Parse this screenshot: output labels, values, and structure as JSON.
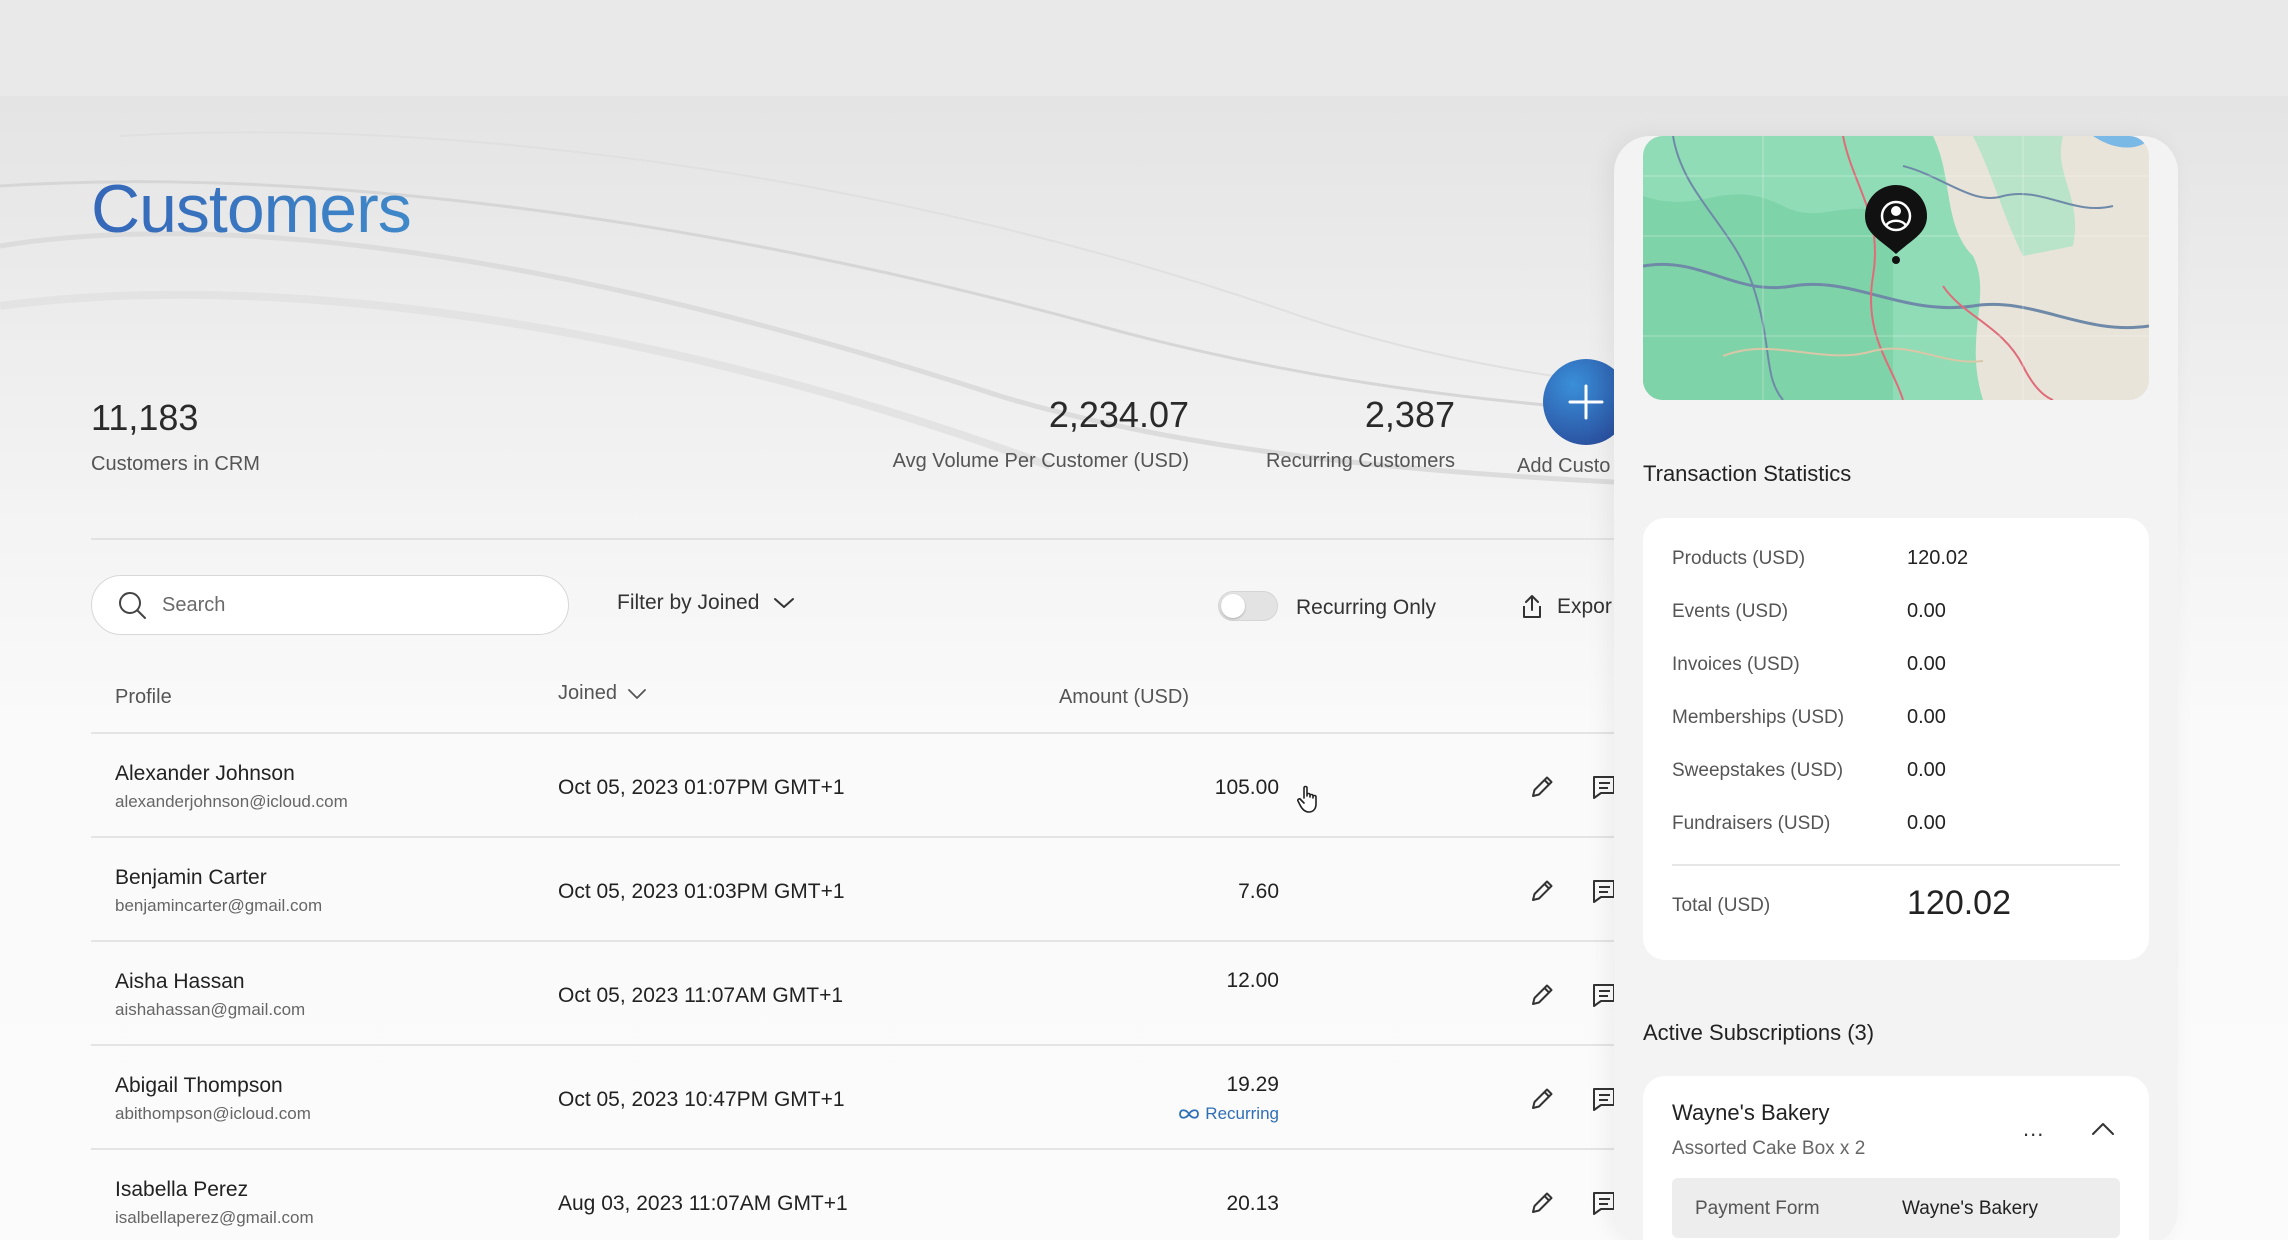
{
  "page": {
    "title": "Customers"
  },
  "stats": {
    "crm_count": "11,183",
    "crm_label": "Customers in CRM",
    "avg_volume": "2,234.07",
    "avg_volume_label": "Avg Volume Per Customer (USD)",
    "recurring": "2,387",
    "recurring_label": "Recurring Customers"
  },
  "add_customer": {
    "label": "Add Custo"
  },
  "toolbar": {
    "search_placeholder": "Search",
    "filter_label": "Filter by Joined",
    "toggle_label": "Recurring Only",
    "toggle_on": false,
    "export_label": "Expor"
  },
  "table": {
    "headers": {
      "profile": "Profile",
      "joined": "Joined",
      "amount": "Amount (USD)"
    },
    "rows": [
      {
        "name": "Alexander Johnson",
        "email": "alexanderjohnson@icloud.com",
        "joined": "Oct 05, 2023 01:07PM GMT+1",
        "amount": "105.00",
        "recurring": ""
      },
      {
        "name": "Benjamin Carter",
        "email": "benjamincarter@gmail.com",
        "joined": "Oct 05, 2023 01:03PM GMT+1",
        "amount": "7.60",
        "recurring": ""
      },
      {
        "name": "Aisha Hassan",
        "email": "aishahassan@gmail.com",
        "joined": "Oct 05, 2023 11:07AM GMT+1",
        "amount": "12.00",
        "recurring": ""
      },
      {
        "name": "Abigail Thompson",
        "email": "abithompson@icloud.com",
        "joined": "Oct 05, 2023 10:47PM GMT+1",
        "amount": "19.29",
        "recurring": "Recurring"
      },
      {
        "name": "Isabella Perez",
        "email": "isalbellaperez@gmail.com",
        "joined": "Aug 03, 2023 11:07AM GMT+1",
        "amount": "20.13",
        "recurring": ""
      }
    ]
  },
  "panel": {
    "transaction_title": "Transaction Statistics",
    "transactions": [
      {
        "label": "Products (USD)",
        "value": "120.02"
      },
      {
        "label": "Events (USD)",
        "value": "0.00"
      },
      {
        "label": "Invoices (USD)",
        "value": "0.00"
      },
      {
        "label": "Memberships (USD)",
        "value": "0.00"
      },
      {
        "label": "Sweepstakes (USD)",
        "value": "0.00"
      },
      {
        "label": "Fundraisers (USD)",
        "value": "0.00"
      }
    ],
    "total_label": "Total (USD)",
    "total_value": "120.02",
    "subscriptions_title": "Active Subscriptions (3)",
    "subscription": {
      "name": "Wayne's Bakery",
      "desc": "Assorted Cake Box x 2",
      "more": "...",
      "payment_label": "Payment Form",
      "payment_value": "Wayne's Bakery"
    }
  },
  "colors": {
    "accent": "#2f6fb5",
    "title_from": "#3567b8",
    "title_to": "#3f88c9",
    "map_green": "#7fd9b0"
  }
}
